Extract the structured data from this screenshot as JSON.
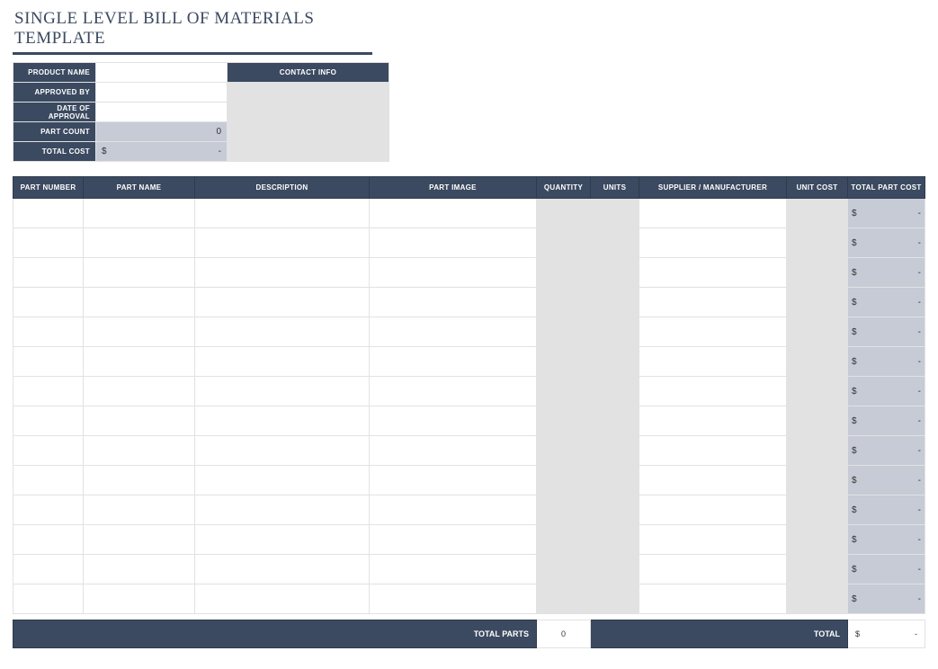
{
  "title": "SINGLE LEVEL BILL OF MATERIALS TEMPLATE",
  "info": {
    "product_name_label": "PRODUCT NAME",
    "product_name_value": "",
    "contact_info_label": "CONTACT INFO",
    "approved_by_label": "APPROVED BY",
    "approved_by_value": "",
    "contact1_value": "",
    "date_of_approval_label": "DATE OF APPROVAL",
    "date_of_approval_value": "",
    "contact2_value": "",
    "part_count_label": "PART COUNT",
    "part_count_value": "0",
    "total_cost_label": "TOTAL COST",
    "total_cost_currency": "$",
    "total_cost_value": "-"
  },
  "columns": {
    "part_number": "PART NUMBER",
    "part_name": "PART NAME",
    "description": "DESCRIPTION",
    "part_image": "PART IMAGE",
    "quantity": "QUANTITY",
    "units": "UNITS",
    "supplier": "SUPPLIER / MANUFACTURER",
    "unit_cost": "UNIT COST",
    "total_part_cost": "TOTAL PART COST"
  },
  "rows": [
    {
      "currency": "$",
      "value": "-"
    },
    {
      "currency": "$",
      "value": "-"
    },
    {
      "currency": "$",
      "value": "-"
    },
    {
      "currency": "$",
      "value": "-"
    },
    {
      "currency": "$",
      "value": "-"
    },
    {
      "currency": "$",
      "value": "-"
    },
    {
      "currency": "$",
      "value": "-"
    },
    {
      "currency": "$",
      "value": "-"
    },
    {
      "currency": "$",
      "value": "-"
    },
    {
      "currency": "$",
      "value": "-"
    },
    {
      "currency": "$",
      "value": "-"
    },
    {
      "currency": "$",
      "value": "-"
    },
    {
      "currency": "$",
      "value": "-"
    },
    {
      "currency": "$",
      "value": "-"
    }
  ],
  "footer": {
    "total_parts_label": "TOTAL PARTS",
    "total_parts_value": "0",
    "total_label": "TOTAL",
    "total_currency": "$",
    "total_value": "-"
  }
}
